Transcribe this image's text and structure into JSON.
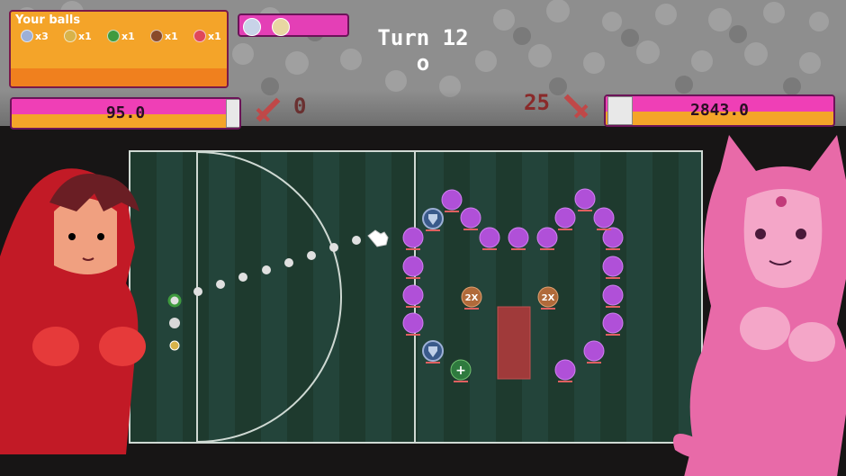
{
  "hud": {
    "balls_panel": {
      "title": "Your balls",
      "items": [
        {
          "icon": "multi-ball-icon",
          "color": "#9db0d6",
          "count": "x3"
        },
        {
          "icon": "gold-ball-icon",
          "color": "#d8b34a",
          "count": "x1"
        },
        {
          "icon": "green-ball-icon",
          "color": "#3e9a3e",
          "count": "x1"
        },
        {
          "icon": "brown-ball-icon",
          "color": "#8a4a2a",
          "count": "x1"
        },
        {
          "icon": "red-ball-icon",
          "color": "#e0475a",
          "count": "x1"
        }
      ]
    },
    "turn_label": "Turn 12",
    "turn_sub": "o",
    "player_hp": "95.0",
    "enemy_hp": "2843.0",
    "player_damage": "0",
    "enemy_damage": "25"
  },
  "field": {
    "pegs_purple_color": "#b050d8",
    "multiplier_label": "2X",
    "plus_label": "+",
    "colors": {
      "accent": "#ef3fb6",
      "bar_fill": "#f4a429",
      "field_dark": "#1e3a2e",
      "field_light": "#23443a"
    }
  }
}
